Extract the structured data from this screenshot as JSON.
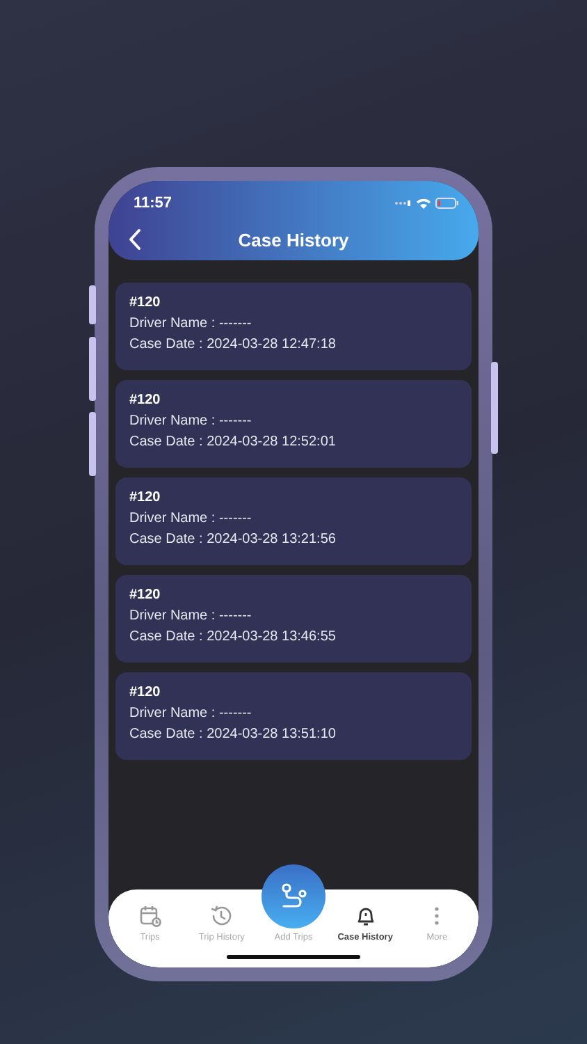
{
  "status_bar": {
    "time": "11:57"
  },
  "header": {
    "title": "Case History"
  },
  "cases": [
    {
      "number": "#120",
      "driver": "Driver Name : -------",
      "date": "Case Date : 2024-03-28 12:47:18"
    },
    {
      "number": "#120",
      "driver": "Driver Name : -------",
      "date": "Case Date : 2024-03-28 12:52:01"
    },
    {
      "number": "#120",
      "driver": "Driver Name : -------",
      "date": "Case Date : 2024-03-28 13:21:56"
    },
    {
      "number": "#120",
      "driver": "Driver Name : -------",
      "date": "Case Date : 2024-03-28 13:46:55"
    },
    {
      "number": "#120",
      "driver": "Driver Name : -------",
      "date": "Case Date : 2024-03-28 13:51:10"
    }
  ],
  "nav": [
    {
      "kind": "calendar",
      "label": "Trips",
      "selected": false
    },
    {
      "kind": "history",
      "label": "Trip History",
      "selected": false
    },
    {
      "kind": "route",
      "label": "Add Trips",
      "selected": false
    },
    {
      "kind": "bell",
      "label": "Case History",
      "selected": true
    },
    {
      "kind": "more",
      "label": "More",
      "selected": false
    }
  ]
}
